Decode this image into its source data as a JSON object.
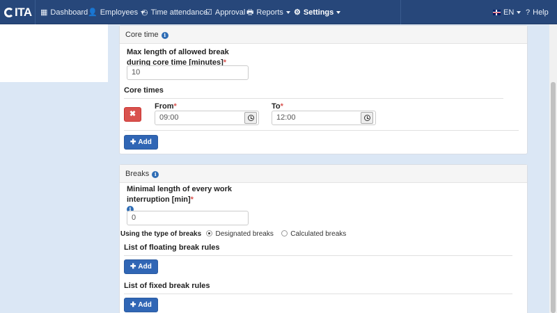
{
  "app": {
    "logo": "ITA"
  },
  "nav": {
    "dashboard": "Dashboard",
    "employees": "Employees",
    "time_attendance": "Time attendance",
    "approval": "Approval",
    "reports": "Reports",
    "settings": "Settings",
    "language": "EN",
    "help": "Help"
  },
  "core_time": {
    "title": "Core time",
    "max_break_label": "Max length of allowed break during core time [minutes]",
    "max_break_value": "10",
    "core_times_label": "Core times",
    "from_label": "From",
    "to_label": "To",
    "from_value": "09:00",
    "to_value": "12:00",
    "delete_label": "✖",
    "add_label": "Add"
  },
  "breaks": {
    "title": "Breaks",
    "min_length_label": "Minimal length of every work interruption [min]",
    "min_length_value": "0",
    "type_label": "Using the type of breaks",
    "options": [
      "Designated breaks",
      "Calculated breaks"
    ],
    "selected_option": "Designated breaks",
    "floating_label": "List of floating break rules",
    "fixed_label": "List of fixed break rules",
    "add_label": "Add"
  },
  "required_mark": "*",
  "colors": {
    "navbar": "#27477a",
    "primary": "#3066b5",
    "danger": "#d9534f",
    "background": "#dbe7f5"
  }
}
